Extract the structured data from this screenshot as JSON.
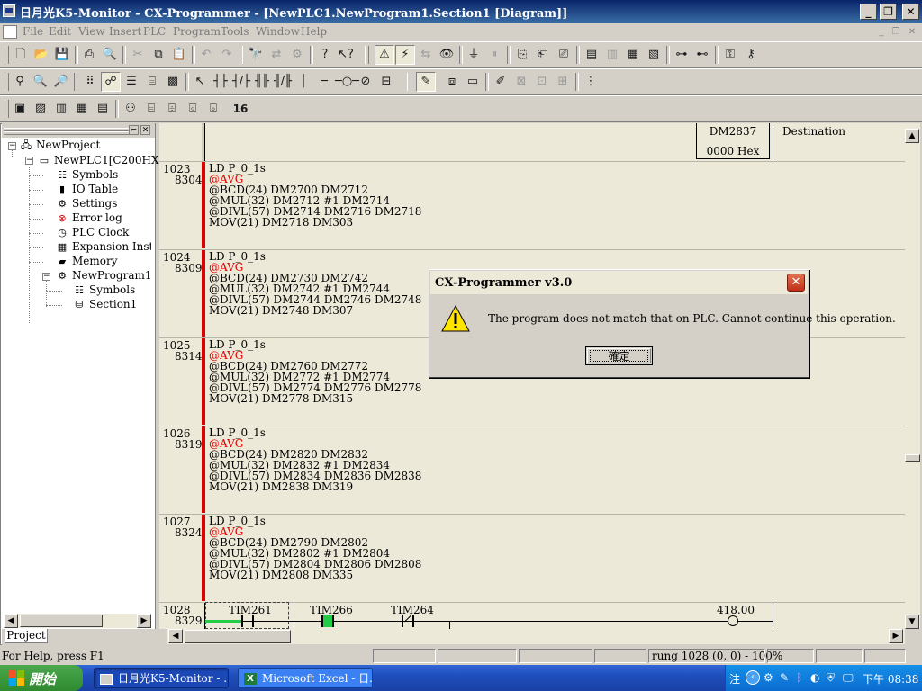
{
  "window": {
    "title": "日月光K5-Monitor - CX-Programmer - [NewPLC1.NewProgram1.Section1 [Diagram]]",
    "minimize": "_",
    "restore": "❐",
    "close": "✕"
  },
  "menu": [
    "File",
    "Edit",
    "View",
    "Insert",
    "PLC",
    "Program",
    "Tools",
    "Window",
    "Help"
  ],
  "tree": {
    "project": "NewProject",
    "plc": "NewPLC1[C200HX]",
    "items": [
      "Symbols",
      "IO Table",
      "Settings",
      "Error log",
      "PLC Clock",
      "Expansion Instruc",
      "Memory"
    ],
    "program": "NewProgram1",
    "program_items": [
      "Symbols",
      "Section1"
    ],
    "tab": "Project"
  },
  "diagram": {
    "header_box": {
      "line1": "DM2837",
      "line2": "0000 Hex"
    },
    "header_label": "Destination",
    "rungs": [
      {
        "rung": "1023",
        "step": "8304",
        "lines": [
          "LD P_0_1s",
          "@AVG",
          "@BCD(24) DM2700 DM2712",
          "@MUL(32) DM2712 #1 DM2714",
          "@DIVL(57) DM2714 DM2716 DM2718",
          "MOV(21) DM2718 DM303"
        ]
      },
      {
        "rung": "1024",
        "step": "8309",
        "lines": [
          "LD P_0_1s",
          "@AVG",
          "@BCD(24) DM2730 DM2742",
          "@MUL(32) DM2742 #1 DM2744",
          "@DIVL(57) DM2744 DM2746 DM2748",
          "MOV(21) DM2748 DM307"
        ]
      },
      {
        "rung": "1025",
        "step": "8314",
        "lines": [
          "LD P_0_1s",
          "@AVG",
          "@BCD(24) DM2760 DM2772",
          "@MUL(32) DM2772 #1 DM2774",
          "@DIVL(57) DM2774 DM2776 DM2778",
          "MOV(21) DM2778 DM315"
        ]
      },
      {
        "rung": "1026",
        "step": "8319",
        "lines": [
          "LD P_0_1s",
          "@AVG",
          "@BCD(24) DM2820 DM2832",
          "@MUL(32) DM2832 #1 DM2834",
          "@DIVL(57) DM2834 DM2836 DM2838",
          "MOV(21) DM2838 DM319"
        ]
      },
      {
        "rung": "1027",
        "step": "8324",
        "lines": [
          "LD P_0_1s",
          "@AVG",
          "@BCD(24) DM2790 DM2802",
          "@MUL(32) DM2802 #1 DM2804",
          "@DIVL(57) DM2804 DM2806 DM2808",
          "MOV(21) DM2808 DM335"
        ]
      }
    ],
    "last_rung": {
      "rung": "1028",
      "step": "8329",
      "contacts": [
        "TIM261",
        "TIM266",
        "TIM264"
      ],
      "coil": "418.00"
    }
  },
  "dialog": {
    "title": "CX-Programmer v3.0",
    "message": "The program does not match that on PLC.  Cannot continue this operation.",
    "ok": "確定",
    "close": "✕"
  },
  "status": {
    "help": "For Help, press F1",
    "rung": "rung 1028 (0, 0)  - 100%"
  },
  "taskbar": {
    "start": "開始",
    "task1": "日月光K5-Monitor - ...",
    "task2": "Microsoft Excel - 日...",
    "clock": "下午 08:38",
    "ime": "注"
  }
}
